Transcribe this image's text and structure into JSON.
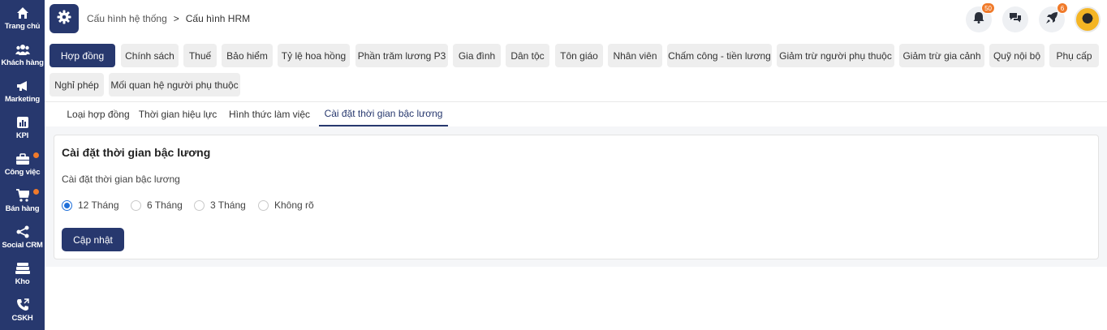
{
  "sidebar": {
    "items": [
      {
        "label": "Trang chủ",
        "icon": "home-icon"
      },
      {
        "label": "Khách hàng",
        "icon": "users-icon"
      },
      {
        "label": "Marketing",
        "icon": "megaphone-icon"
      },
      {
        "label": "KPI",
        "icon": "chart-icon"
      },
      {
        "label": "Công việc",
        "icon": "briefcase-icon"
      },
      {
        "label": "Bán hàng",
        "icon": "cart-icon"
      },
      {
        "label": "Social CRM",
        "icon": "share-icon"
      },
      {
        "label": "Kho",
        "icon": "warehouse-icon"
      },
      {
        "label": "CSKH",
        "icon": "phone-icon"
      }
    ]
  },
  "header": {
    "breadcrumb_1": "Cấu hình hệ thống",
    "breadcrumb_sep": ">",
    "breadcrumb_2": "Cấu hình HRM",
    "notification_count": "50",
    "rocket_count": "6"
  },
  "categories": [
    "Hợp đồng",
    "Chính sách",
    "Thuế",
    "Bảo hiểm",
    "Tỷ lệ hoa hồng",
    "Phần trăm lương P3",
    "Gia đình",
    "Dân tộc",
    "Tôn giáo",
    "Nhân viên",
    "Chấm công - tiền lương",
    "Giảm trừ người phụ thuộc",
    "Giảm trừ gia cảnh",
    "Quỹ nội bộ",
    "Phụ cấp",
    "Nghỉ phép",
    "Mối quan hệ người phụ thuộc"
  ],
  "tabs": [
    "Loại hợp đồng",
    "Thời gian hiệu lực",
    "Hình thức làm việc",
    "Cài đặt thời gian bậc lương"
  ],
  "card": {
    "title": "Cài đặt thời gian bậc lương",
    "subtitle": "Cài đặt thời gian bậc lương",
    "options": [
      "12 Tháng",
      "6 Tháng",
      "3 Tháng",
      "Không rõ"
    ],
    "selected": "12 Tháng",
    "button": "Cập nhật"
  },
  "colors": {
    "primary": "#27386e",
    "badge": "#f07a2a",
    "radio": "#1e6fd9"
  }
}
